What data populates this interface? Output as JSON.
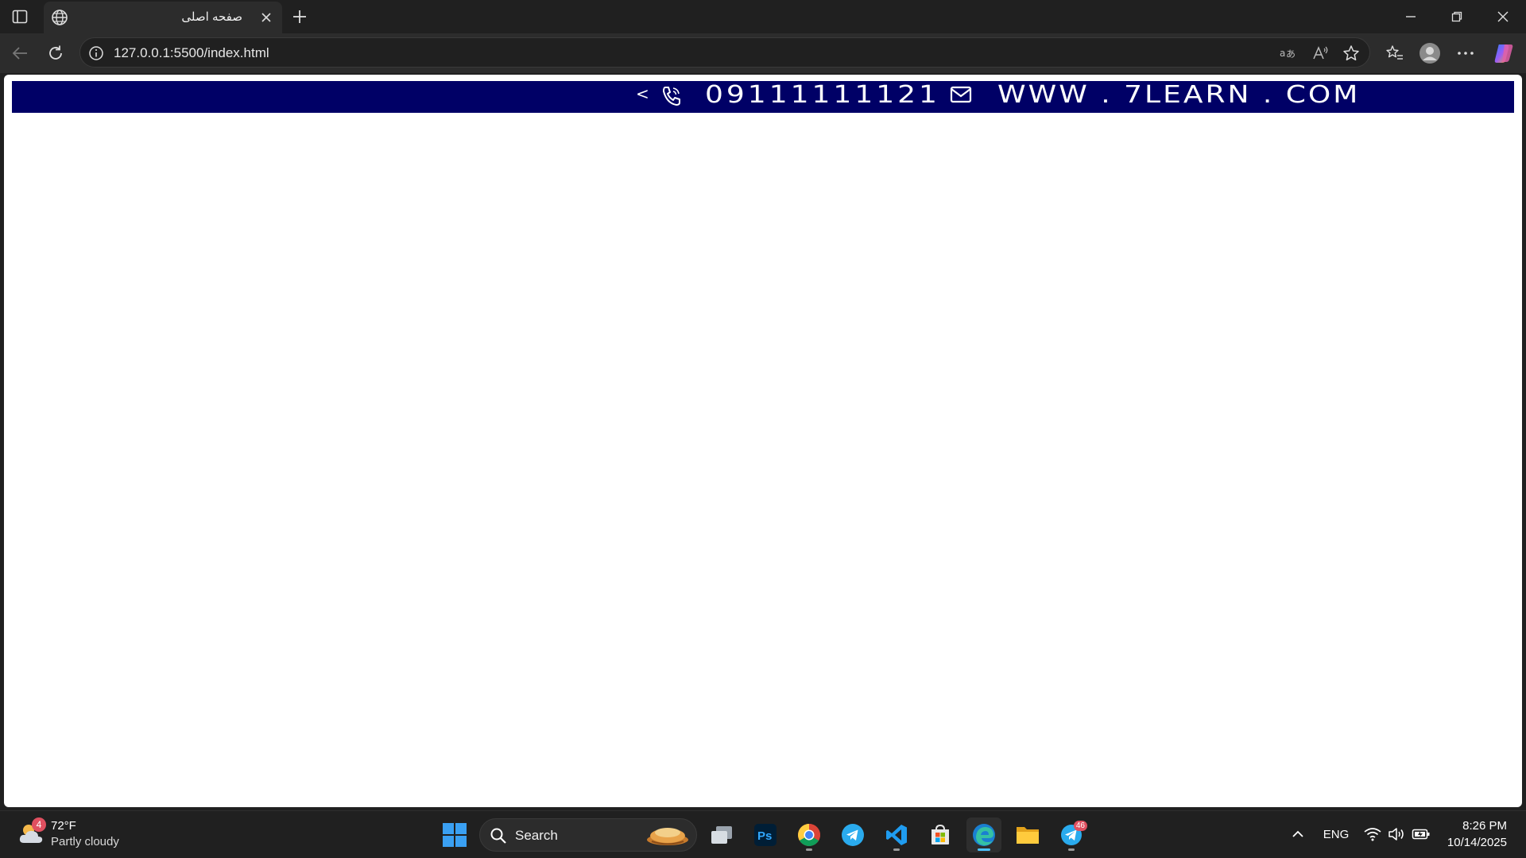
{
  "browser": {
    "tab": {
      "title": "صفحه اصلی"
    },
    "url": "127.0.0.1:5500/index.html"
  },
  "page": {
    "banner": {
      "chevron": "<",
      "phone": "09111111121",
      "website": "WWW . 7LEARN . COM",
      "background": "#000066"
    }
  },
  "taskbar": {
    "weather": {
      "badge": "4",
      "temperature": "72°F",
      "condition": "Partly cloudy"
    },
    "search": {
      "label": "Search"
    },
    "apps": [
      "task-view",
      "photoshop",
      "chrome",
      "telegram",
      "vscode",
      "microsoft-store",
      "edge",
      "file-explorer",
      "telegram-desktop"
    ],
    "telegram_badge": "46",
    "tray": {
      "language": "ENG"
    },
    "clock": {
      "time": "8:26 PM",
      "date": "10/14/2025"
    }
  },
  "colors": {
    "accent": "#4cc2ff",
    "titlebar": "#202020",
    "toolbar": "#2c2c2c"
  }
}
